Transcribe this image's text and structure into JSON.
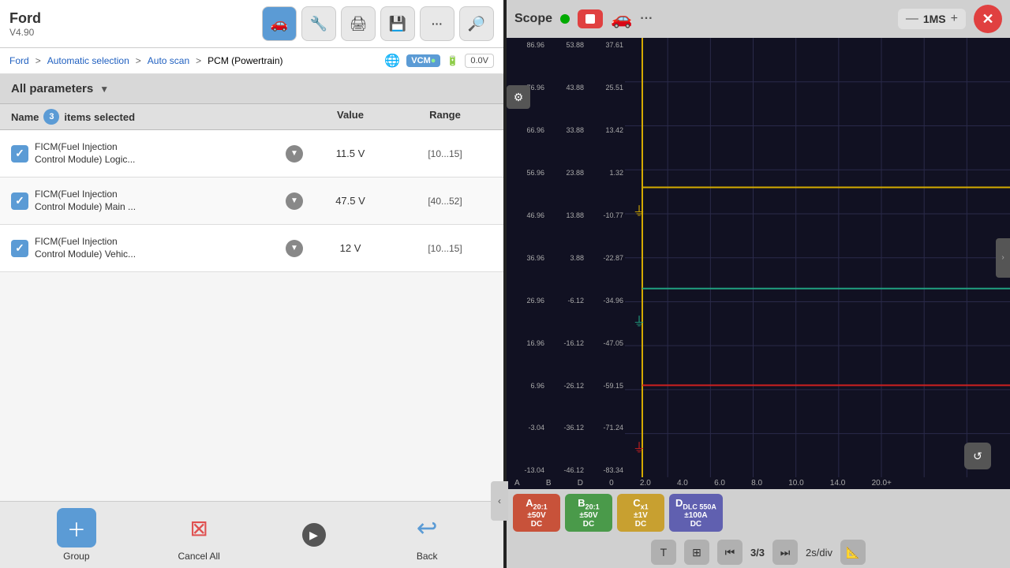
{
  "leftPanel": {
    "title": "Ford",
    "version": "V4.90",
    "topIcons": [
      {
        "name": "car-icon",
        "symbol": "🚗",
        "active": true
      },
      {
        "name": "scan-icon",
        "symbol": "🔍",
        "active": false
      },
      {
        "name": "print-icon",
        "symbol": "🖨",
        "active": false
      },
      {
        "name": "save-icon",
        "symbol": "💾",
        "active": false
      },
      {
        "name": "more-icon",
        "symbol": "···",
        "active": false
      },
      {
        "name": "search-icon",
        "symbol": "🔎",
        "active": false
      }
    ],
    "breadcrumbs": [
      {
        "label": "Ford",
        "link": true
      },
      {
        "label": "Automatic selection",
        "link": true
      },
      {
        "label": "Auto scan",
        "link": true
      },
      {
        "label": "PCM (Powertrain)",
        "link": false
      }
    ],
    "wifiLabel": "",
    "vcmLabel": "VCM",
    "voltageLabel": "0.0V",
    "filterLabel": "All parameters",
    "tableHeader": {
      "name": "Name",
      "selectedCount": "3",
      "selectedText": "items selected",
      "value": "Value",
      "range": "Range"
    },
    "rows": [
      {
        "id": "row1",
        "checked": true,
        "name": "FICM(Fuel Injection Control Module) Logic...",
        "value": "11.5 V",
        "range": "[10...15]"
      },
      {
        "id": "row2",
        "checked": true,
        "name": "FICM(Fuel Injection Control Module) Main ...",
        "value": "47.5 V",
        "range": "[40...52]"
      },
      {
        "id": "row3",
        "checked": true,
        "name": "FICM(Fuel Injection Control Module) Vehic...",
        "value": "12 V",
        "range": "[10...15]"
      }
    ],
    "bottomBar": {
      "groupLabel": "Group",
      "cancelAllLabel": "Cancel All",
      "backLabel": "Back"
    }
  },
  "rightPanel": {
    "title": "Scope",
    "timeScale": "1MS",
    "yAxisLeft": [
      "86.96",
      "76.96",
      "66.96",
      "56.96",
      "46.96",
      "36.96",
      "26.96",
      "16.96",
      "6.96",
      "-3.04",
      "-13.04"
    ],
    "yAxisMid": [
      "53.88",
      "43.88",
      "33.88",
      "23.88",
      "13.88",
      "3.88",
      "-6.12",
      "-16.12",
      "-26.12",
      "-36.12",
      "-46.12"
    ],
    "yAxisRight": [
      "37.61",
      "25.51",
      "13.42",
      "1.32",
      "-10.77",
      "-22.87",
      "-34.96",
      "-47.05",
      "-59.15",
      "-71.24",
      "-83.34"
    ],
    "xAxisLabels": [
      "A",
      "B",
      "D",
      "0",
      "2.0",
      "4.0",
      "6.0",
      "8.0",
      "10.0",
      "14.0",
      "20.0"
    ],
    "channels": [
      {
        "id": "A",
        "label": "A",
        "sub": "20:1",
        "range": "±50V",
        "mode": "DC",
        "color": "#c8523a"
      },
      {
        "id": "B",
        "label": "B",
        "sub": "20:1",
        "range": "±50V",
        "mode": "DC",
        "color": "#4a9a4a"
      },
      {
        "id": "C",
        "label": "C",
        "sub": "x1",
        "range": "±1V",
        "mode": "DC",
        "color": "#c8a030"
      },
      {
        "id": "D",
        "label": "D",
        "sub": "DLC 550A",
        "range": "±100A",
        "mode": "DC",
        "color": "#6060b0"
      }
    ],
    "playback": {
      "tLabel": "T",
      "measureLabel": "⊞",
      "skipBackLabel": "⏮",
      "pageLabel": "3/3",
      "skipFwdLabel": "⏭",
      "timeDiv": "2s/div",
      "rulerLabel": "📐"
    },
    "scopeLines": {
      "yellow": {
        "y": 35,
        "color": "#d4aa00"
      },
      "teal": {
        "y": 57,
        "color": "#20a080"
      },
      "red": {
        "y": 78,
        "color": "#cc2020"
      }
    }
  }
}
